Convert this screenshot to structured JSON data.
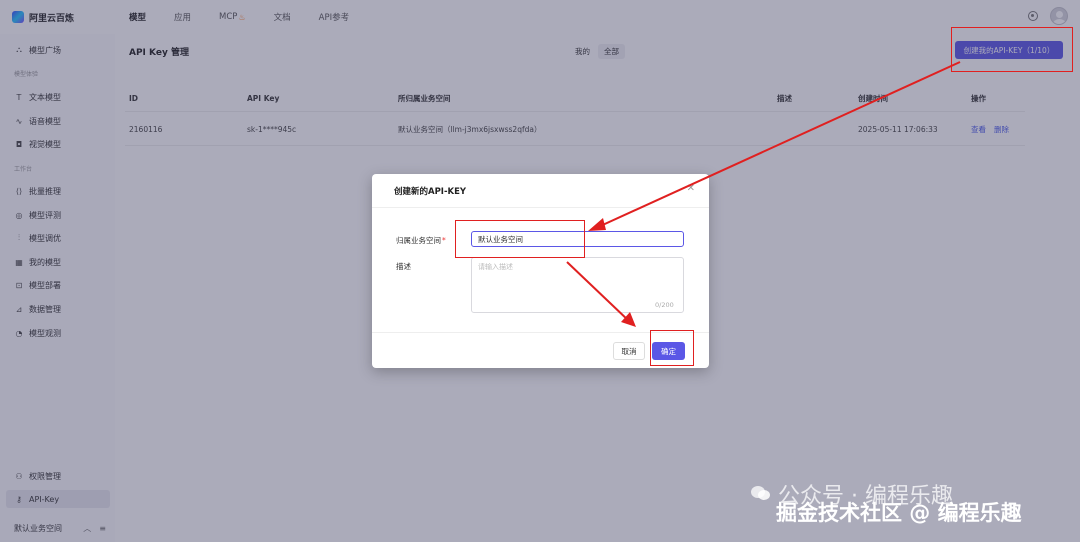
{
  "app": {
    "logo_text": "阿里云百炼"
  },
  "nav": {
    "items": [
      {
        "label": "模型"
      },
      {
        "label": "应用"
      },
      {
        "label": "MCP"
      },
      {
        "label": "文档"
      },
      {
        "label": "API参考"
      }
    ]
  },
  "sidebar": {
    "items": [
      {
        "label": "模型广场",
        "icon": "cubes-icon"
      },
      {
        "label": "文本模型",
        "icon": "text-icon"
      },
      {
        "label": "语音模型",
        "icon": "waveform-icon"
      },
      {
        "label": "视觉模型",
        "icon": "camera-icon"
      },
      {
        "label": "批量推理",
        "icon": "batch-icon"
      },
      {
        "label": "模型评测",
        "icon": "target-icon"
      },
      {
        "label": "模型调优",
        "icon": "sliders-icon"
      },
      {
        "label": "我的模型",
        "icon": "grid-icon"
      },
      {
        "label": "模型部署",
        "icon": "deploy-icon"
      },
      {
        "label": "数据管理",
        "icon": "chart-icon"
      },
      {
        "label": "模型观测",
        "icon": "pie-icon"
      },
      {
        "label": "权限管理",
        "icon": "user-icon"
      },
      {
        "label": "API-Key",
        "icon": "key-icon"
      }
    ],
    "groups": [
      "模型体验",
      "工作台"
    ],
    "workspace": "默认业务空间"
  },
  "page": {
    "title": "API Key 管理",
    "filter": [
      "我的",
      "全部"
    ],
    "create_button": "创建我的API-KEY（1/10）"
  },
  "table": {
    "headers": [
      "ID",
      "API Key",
      "所归属业务空间",
      "描述",
      "创建时间",
      "操作"
    ],
    "rows": [
      {
        "id": "2160116",
        "key": "sk-1****945c",
        "workspace": "默认业务空间（llm-j3mx6jsxwss2qfda）",
        "desc": "",
        "time": "2025-05-11 17:06:33",
        "ops": [
          "查看",
          "删除"
        ]
      }
    ]
  },
  "dialog": {
    "title": "创建新的API-KEY",
    "workspace_label": "归属业务空间",
    "workspace_required": "*",
    "workspace_value": "默认业务空间",
    "desc_label": "描述",
    "desc_placeholder": "请输入描述",
    "counter": "0/200",
    "cancel": "取消",
    "ok": "确定"
  },
  "watermark": {
    "line1": "公众号 · 编程乐趣",
    "line2": "掘金技术社区 @ 编程乐趣"
  },
  "colors": {
    "accent": "#5b57e6",
    "annotation": "#e02020",
    "link": "#4a5be8"
  }
}
